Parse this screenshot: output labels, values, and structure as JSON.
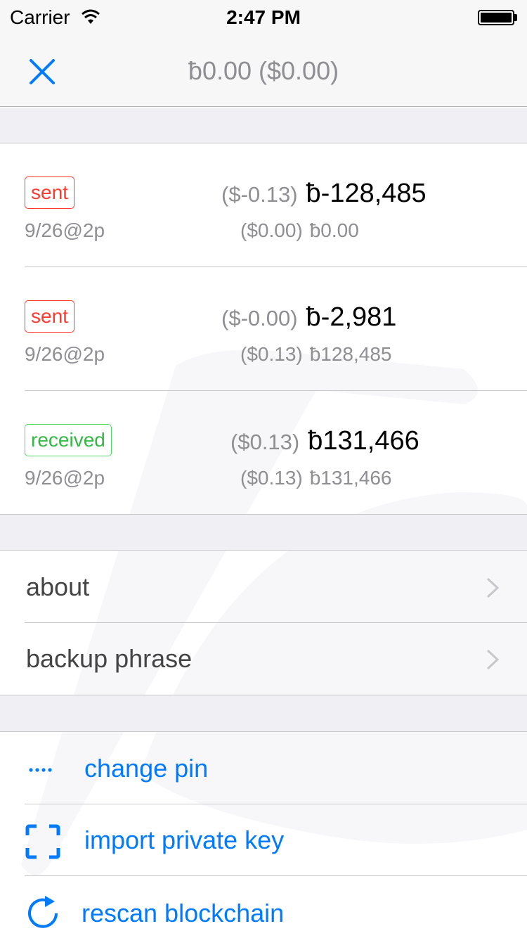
{
  "status_bar": {
    "carrier": "Carrier",
    "time": "2:47 PM",
    "battery_level": 1.0
  },
  "nav": {
    "balance": "ƀ0.00 ($0.00)"
  },
  "transactions": [
    {
      "type": "sent",
      "date": "9/26@2p",
      "amount_usd": "($-0.13)",
      "amount": "ƀ-128,485",
      "balance_usd": "($0.00)",
      "balance": "ƀ0.00"
    },
    {
      "type": "sent",
      "date": "9/26@2p",
      "amount_usd": "($-0.00)",
      "amount": "ƀ-2,981",
      "balance_usd": "($0.13)",
      "balance": "ƀ128,485"
    },
    {
      "type": "received",
      "date": "9/26@2p",
      "amount_usd": "($0.13)",
      "amount": "ƀ131,466",
      "balance_usd": "($0.13)",
      "balance": "ƀ131,466"
    }
  ],
  "menu": {
    "about_label": "about",
    "backup_label": "backup phrase"
  },
  "actions": {
    "change_pin_label": "change pin",
    "import_key_label": "import private key",
    "rescan_label": "rescan blockchain"
  },
  "colors": {
    "accent": "#007aff",
    "sent": "#ff3b30",
    "received": "#4cd964",
    "secondary_text": "#8e8e93",
    "section_background": "#efeff4"
  }
}
